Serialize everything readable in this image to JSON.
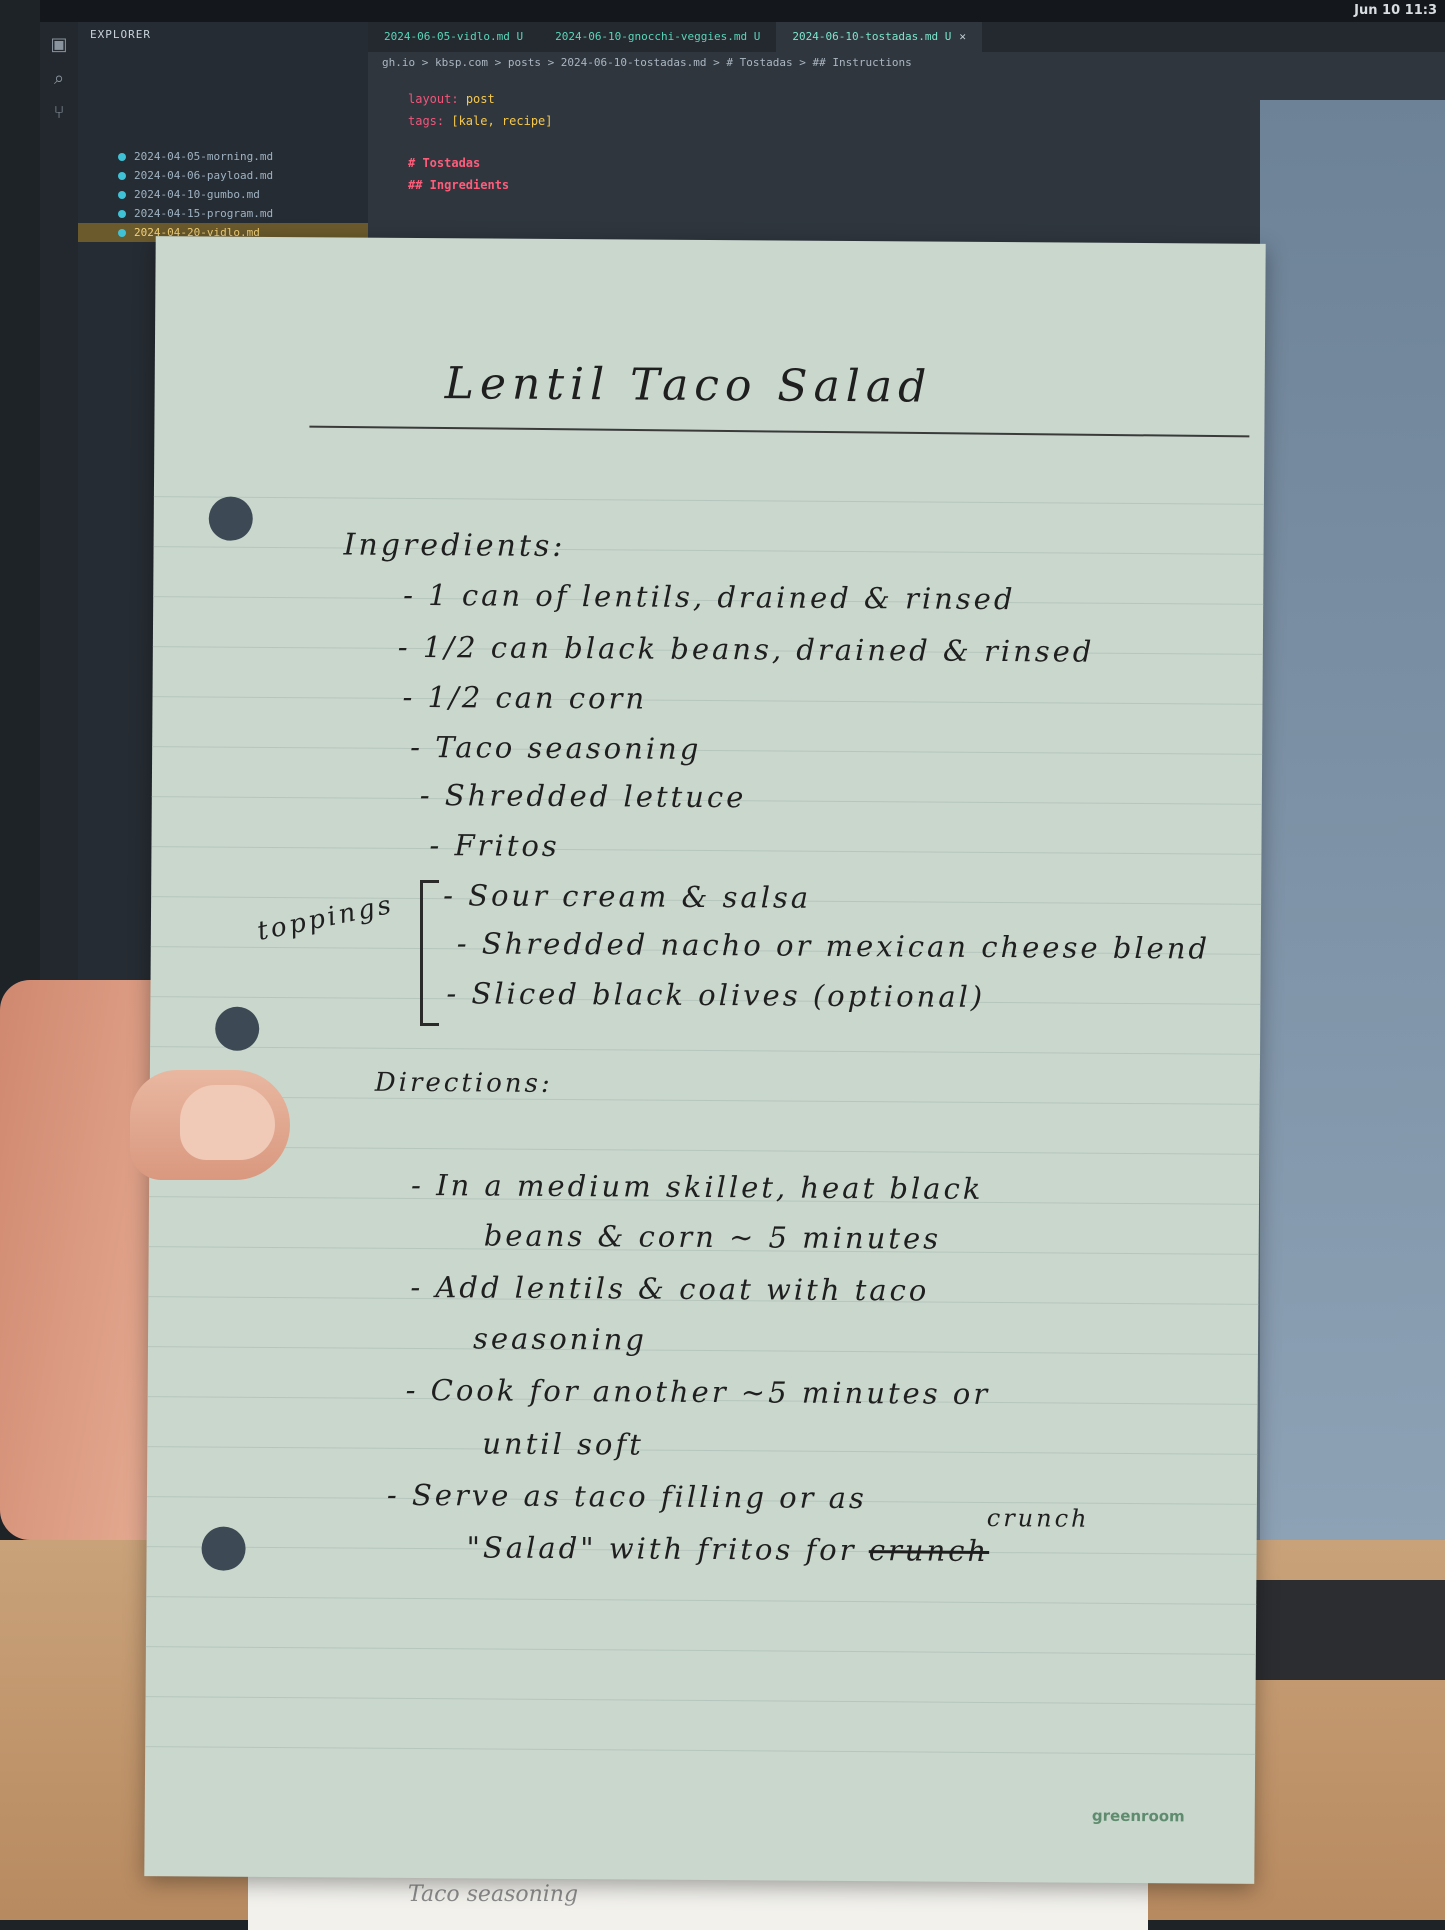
{
  "screen": {
    "menubar_time": "Jun 10 11:3",
    "explorer_header": "EXPLORER",
    "tabs": [
      "2024-06-05-vidlo.md U",
      "2024-06-10-gnocchi-veggies.md U",
      "2024-06-10-tostadas.md U"
    ],
    "breadcrumb": "gh.io > kbsp.com > posts > 2024-06-10-tostadas.md > # Tostadas > ## Instructions",
    "code_lines": [
      {
        "key": "layout:",
        "value": "post"
      },
      {
        "key": "tags:",
        "value": "[kale, recipe]"
      },
      {
        "key": "",
        "value": "# Tostadas"
      },
      {
        "key": "",
        "value": "## Ingredients"
      }
    ],
    "explorer_items": [
      "2024-04-05-morning.md",
      "2024-04-06-payload.md",
      "2024-04-10-gumbo.md",
      "2024-04-15-program.md",
      "2024-04-20-vidlo.md"
    ]
  },
  "note": {
    "title": "Lentil Taco Salad",
    "ingredients_heading": "Ingredients:",
    "ingredients": [
      "- 1 can of lentils, drained & rinsed",
      "- 1/2 can black beans, drained & rinsed",
      "- 1/2 can corn",
      "- Taco seasoning",
      "- Shredded lettuce",
      "- Fritos"
    ],
    "toppings_label": "toppings",
    "toppings": [
      "- Sour cream & salsa",
      "- Shredded nacho or mexican cheese blend",
      "- Sliced black olives (optional)"
    ],
    "directions_heading": "Directions:",
    "directions": [
      {
        "line1": "- In a medium skillet, heat black",
        "line2": "beans & corn ~ 5 minutes"
      },
      {
        "line1": "- Add lentils & coat with taco",
        "line2": "seasoning"
      },
      {
        "line1": "- Cook for another ~5 minutes or",
        "line2": "until soft"
      },
      {
        "line1": "- Serve as taco filling or as",
        "line2_a": "\"Salad\" with fritos for",
        "line2_crossed": "crunch",
        "line2_above": "crunch"
      }
    ],
    "brand": "greenroom",
    "under_paper_text": "Taco seasoning"
  }
}
